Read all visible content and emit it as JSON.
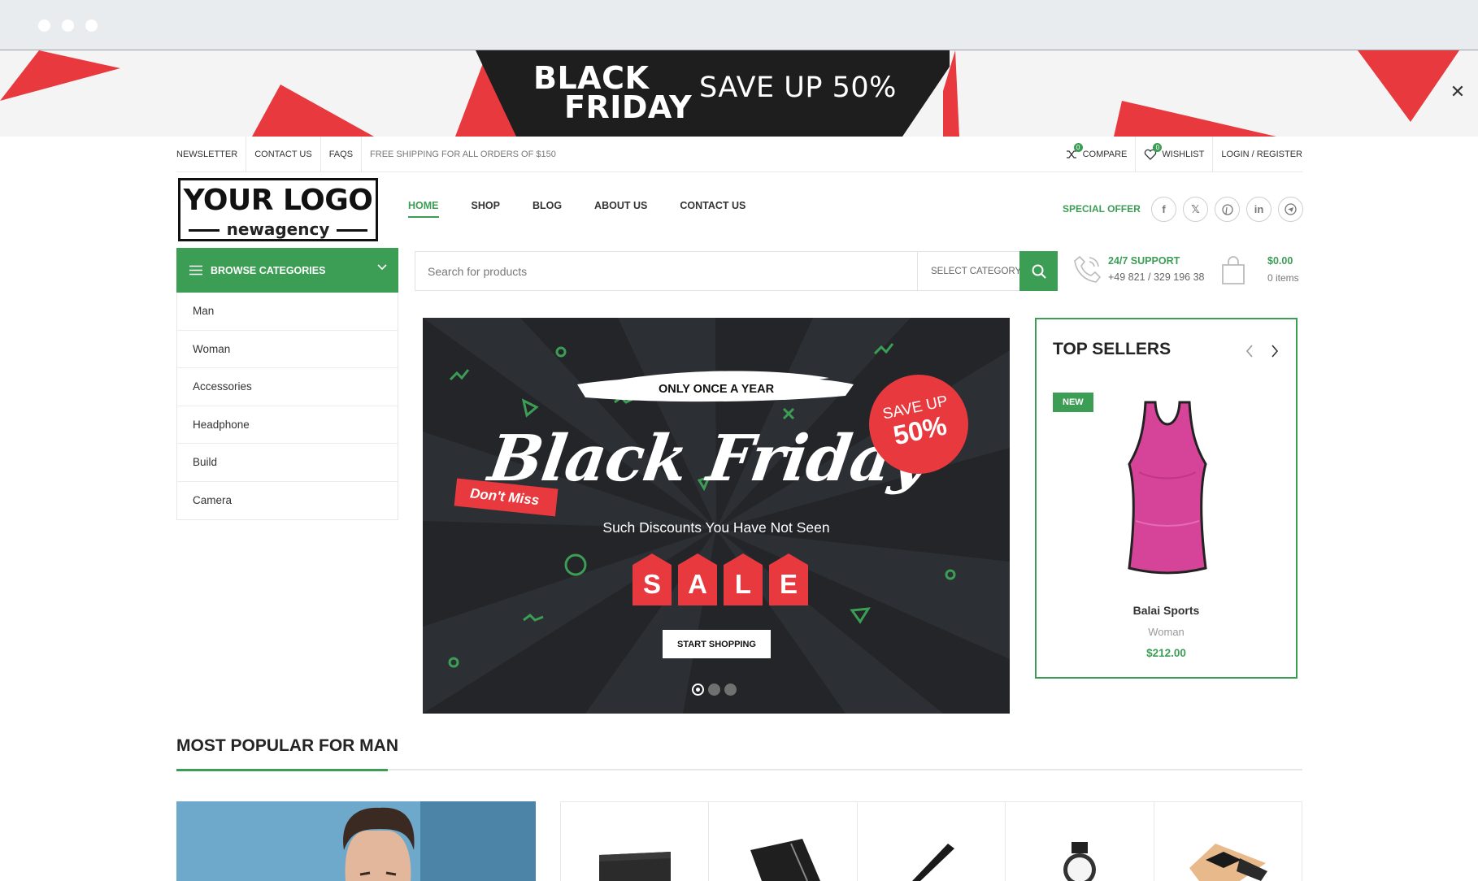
{
  "promo": {
    "title_line1": "BLACK",
    "title_line2": "FRIDAY",
    "save_text": "SAVE UP 50%",
    "close_icon": "close-icon"
  },
  "topbar": {
    "left": [
      "NEWSLETTER",
      "CONTACT US",
      "FAQS"
    ],
    "shipping": "FREE SHIPPING FOR ALL ORDERS OF $150",
    "compare": {
      "label": "COMPARE",
      "count": "0"
    },
    "wishlist": {
      "label": "WISHLIST",
      "count": "0"
    },
    "login": "LOGIN / REGISTER"
  },
  "logo": {
    "main": "YOUR LOGO",
    "sub": "newagency"
  },
  "nav": {
    "items": [
      "HOME",
      "SHOP",
      "BLOG",
      "ABOUT US",
      "CONTACT US"
    ],
    "active": "HOME",
    "special": "SPECIAL OFFER",
    "social": [
      "facebook-icon",
      "x-icon",
      "pinterest-icon",
      "linkedin-icon",
      "telegram-icon"
    ]
  },
  "categories": {
    "browse_label": "BROWSE CATEGORIES",
    "items": [
      "Man",
      "Woman",
      "Accessories",
      "Headphone",
      "Build",
      "Camera"
    ]
  },
  "search": {
    "placeholder": "Search for products",
    "category_label": "SELECT CATEGORY"
  },
  "support": {
    "title": "24/7 SUPPORT",
    "phone": "+49 821 / 329 196 38"
  },
  "cart": {
    "amount": "$0.00",
    "items": "0 items"
  },
  "hero": {
    "once": "ONLY ONCE A YEAR",
    "script_title": "Black Friday",
    "save_line1": "SAVE UP",
    "save_line2": "50%",
    "dont_miss": "Don't Miss",
    "subtitle": "Such Discounts You Have Not Seen",
    "sale_letters": [
      "S",
      "A",
      "L",
      "E"
    ],
    "button": "START SHOPPING",
    "slides_count": 3,
    "active_slide": 1
  },
  "top_sellers": {
    "title": "TOP SELLERS",
    "badge": "NEW",
    "product": {
      "name": "Balai Sports",
      "category": "Woman",
      "price": "$212.00"
    }
  },
  "most_popular": {
    "title": "MOST POPULAR FOR MAN"
  },
  "colors": {
    "accent": "#3c9d55",
    "red": "#e7393e",
    "dark": "#232528"
  }
}
